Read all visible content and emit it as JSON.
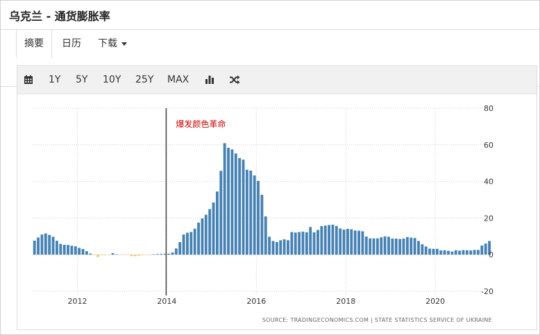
{
  "page": {
    "title": "乌克兰 - 通货膨胀率"
  },
  "tabs": [
    {
      "label": "摘要",
      "active": true
    },
    {
      "label": "日历",
      "active": false
    },
    {
      "label": "下载",
      "active": false
    }
  ],
  "toolbar": {
    "calendar_icon": "calendar-icon",
    "ranges": [
      "1Y",
      "5Y",
      "10Y",
      "25Y",
      "MAX"
    ],
    "bar_icon": "bar-chart-icon",
    "shuffle_icon": "shuffle-icon"
  },
  "colors": {
    "bar": "#4682b4",
    "negative_bar": "#f5c26b",
    "annotation": "#cc0000",
    "event_line": "#444444"
  },
  "chart_data": {
    "type": "bar",
    "x_ticks": [
      "2012",
      "2014",
      "2016",
      "2018",
      "2020"
    ],
    "y_ticks": [
      "80",
      "60",
      "40",
      "20",
      "0",
      "-20"
    ],
    "ylim": [
      -20,
      80
    ],
    "xlim": [
      "2011-01",
      "2021-02"
    ],
    "grid": true,
    "y_axis_position": "right",
    "annotation": {
      "text": "爆发颜色革命",
      "date": "2014-01"
    },
    "source": "SOURCE: TRADINGECONOMICS.COM  |  STATE STATISTICS SERVICE OF UKRAINE",
    "series": [
      {
        "values": [
          7.7,
          9.4,
          11.0,
          11.6,
          10.8,
          9.8,
          7.6,
          5.9,
          5.4,
          5.3,
          4.9,
          4.6,
          3.7,
          3.1,
          1.9,
          0.6,
          -0.3,
          -1.2,
          -0.3,
          -0.3,
          -0.1,
          0.8,
          0.1,
          -0.2,
          -0.2,
          -0.2,
          -0.8,
          -0.8,
          -0.6,
          -0.3,
          -0.2,
          -0.2,
          0.1,
          0.3,
          0.4,
          0.5,
          0.5,
          1.2,
          3.4,
          6.9,
          11.0,
          12.0,
          12.4,
          14.2,
          17.5,
          19.8,
          21.8,
          24.9,
          28.5,
          34.5,
          45.8,
          60.9,
          58.4,
          57.5,
          55.3,
          52.8,
          51.9,
          46.4,
          45.9,
          43.3,
          40.3,
          32.7,
          20.9,
          9.8,
          7.5,
          6.9,
          7.9,
          8.4,
          7.9,
          12.4,
          12.1,
          12.4,
          12.6,
          12.2,
          15.1,
          12.2,
          13.5,
          15.6,
          15.9,
          16.2,
          16.4,
          15.7,
          14.3,
          13.7,
          14.1,
          13.9,
          13.2,
          13.1,
          12.8,
          9.9,
          8.9,
          8.9,
          8.9,
          9.5,
          10.0,
          9.8,
          8.8,
          8.8,
          8.6,
          8.8,
          9.6,
          9.3,
          9.1,
          7.5,
          5.7,
          4.5,
          3.3,
          3.2,
          3.2,
          2.3,
          2.4,
          2.1,
          1.7,
          2.4,
          2.2,
          2.5,
          2.4,
          2.3,
          2.6,
          2.6,
          5.0,
          6.1,
          7.5
        ]
      }
    ]
  }
}
